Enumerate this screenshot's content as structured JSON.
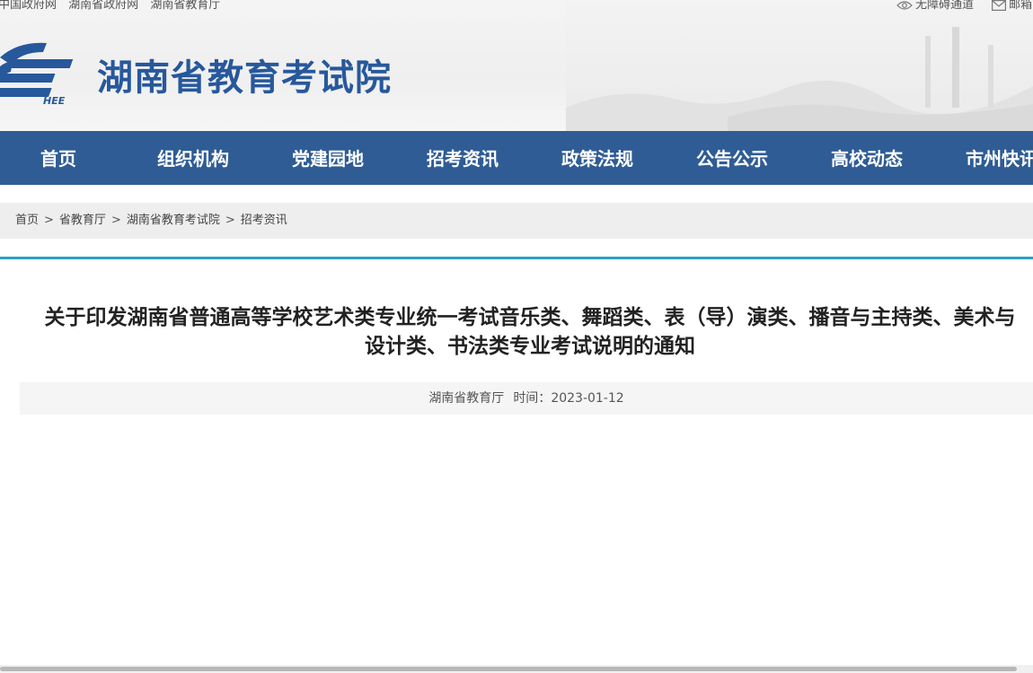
{
  "top_links": [
    "中国政府网",
    "湖南省政府网",
    "湖南省教育厅"
  ],
  "top_right": {
    "accessibility": "无障碍通道",
    "mail": "邮箱"
  },
  "header": {
    "site_title": "湖南省教育考试院",
    "logo_text": "HEE",
    "brand_color": "#27589c"
  },
  "nav": {
    "background": "#2f5c95",
    "items": [
      "首页",
      "组织机构",
      "党建园地",
      "招考资讯",
      "政策法规",
      "公告公示",
      "高校动态",
      "市州快讯"
    ]
  },
  "breadcrumb": [
    "首页",
    "省教育厅",
    "湖南省教育考试院",
    "招考资讯"
  ],
  "breadcrumb_sep": ">",
  "article": {
    "title": "关于印发湖南省普通高等学校艺术类专业统一考试音乐类、舞蹈类、表（导）演类、播音与主持类、美术与设计类、书法类专业考试说明的通知",
    "source": "湖南省教育厅",
    "time_label": "时间：",
    "date": "2023-01-12"
  }
}
